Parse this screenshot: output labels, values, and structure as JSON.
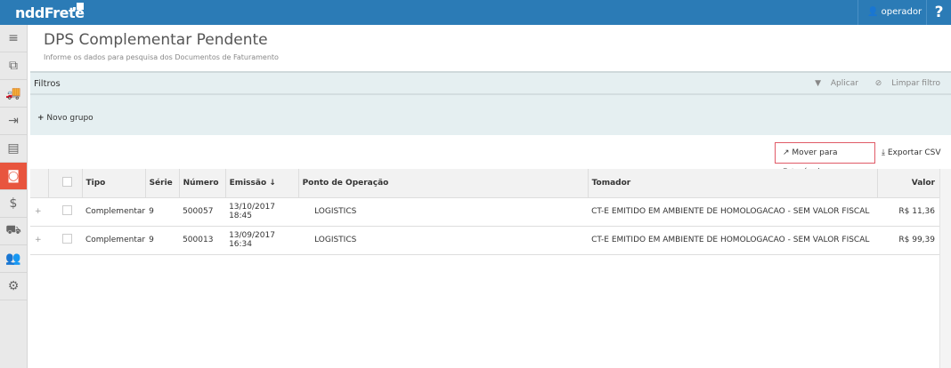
{
  "header": {
    "logo": "nddFrete",
    "user": "operador",
    "help": "?"
  },
  "sidebar": {
    "items": [
      "menu-icon",
      "documents-icon",
      "truck-icon",
      "export-icon",
      "file-icon",
      "money-icon",
      "exchange-icon",
      "delivery-icon",
      "users-icon",
      "settings-icon"
    ],
    "active_color": "#e8553e"
  },
  "page": {
    "title": "DPS Complementar Pendente",
    "subtitle": "Informe os dados para pesquisa dos Documentos de Faturamento"
  },
  "filters": {
    "label": "Filtros",
    "apply": "Aplicar",
    "clear": "Limpar filtro",
    "new_group": "Novo grupo"
  },
  "actions": {
    "move": "Mover para Faturável",
    "export": "Exportar CSV"
  },
  "table": {
    "headers": [
      "Tipo",
      "Série",
      "Número",
      "Emissão ↓",
      "Ponto de Operação",
      "Tomador",
      "Valor"
    ],
    "rows": [
      {
        "tipo": "Complementar",
        "serie": "9",
        "numero": "500057",
        "emissao": "13/10/2017 18:45",
        "ponto": "LOGISTICS",
        "tomador": "CT-E EMITIDO EM AMBIENTE DE HOMOLOGACAO - SEM VALOR FISCAL",
        "valor": "R$ 11,36"
      },
      {
        "tipo": "Complementar",
        "serie": "9",
        "numero": "500013",
        "emissao": "13/09/2017 16:34",
        "ponto": "LOGISTICS",
        "tomador": "CT-E EMITIDO EM AMBIENTE DE HOMOLOGACAO - SEM VALOR FISCAL",
        "valor": "R$ 99,39"
      }
    ]
  }
}
